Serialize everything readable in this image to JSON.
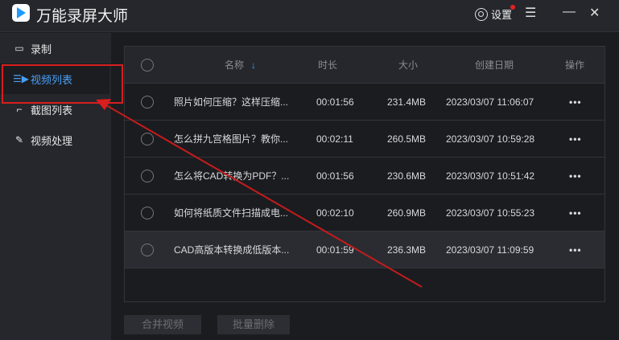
{
  "app": {
    "title": "万能录屏大师"
  },
  "titlebar": {
    "settings": "设置",
    "menu_icon": "☰",
    "minimize": "—",
    "close": "✕"
  },
  "sidebar": {
    "items": [
      {
        "label": "录制",
        "icon": "camera-icon"
      },
      {
        "label": "视频列表",
        "icon": "video-list-icon",
        "active": true
      },
      {
        "label": "截图列表",
        "icon": "screenshot-icon"
      },
      {
        "label": "视频处理",
        "icon": "tools-icon"
      }
    ]
  },
  "table": {
    "headers": {
      "name": "名称",
      "sort": "↓",
      "duration": "时长",
      "size": "大小",
      "date": "创建日期",
      "ops": "操作"
    },
    "rows": [
      {
        "name": "照片如何压缩？这样压缩...",
        "duration": "00:01:56",
        "size": "231.4MB",
        "date": "2023/03/07 11:06:07",
        "ops": "•••"
      },
      {
        "name": "怎么拼九宫格图片？教你...",
        "duration": "00:02:11",
        "size": "260.5MB",
        "date": "2023/03/07 10:59:28",
        "ops": "•••"
      },
      {
        "name": "怎么将CAD转换为PDF？...",
        "duration": "00:01:56",
        "size": "230.6MB",
        "date": "2023/03/07 10:51:42",
        "ops": "•••"
      },
      {
        "name": "如何将纸质文件扫描成电...",
        "duration": "00:02:10",
        "size": "260.9MB",
        "date": "2023/03/07 10:55:23",
        "ops": "•••"
      },
      {
        "name": "CAD高版本转换成低版本...",
        "duration": "00:01:59",
        "size": "236.3MB",
        "date": "2023/03/07 11:09:59",
        "ops": "•••"
      }
    ]
  },
  "actions": {
    "merge": "合并视频",
    "batch_delete": "批量删除"
  },
  "colors": {
    "accent": "#4a9ff5",
    "annotation": "#d81e1e"
  }
}
